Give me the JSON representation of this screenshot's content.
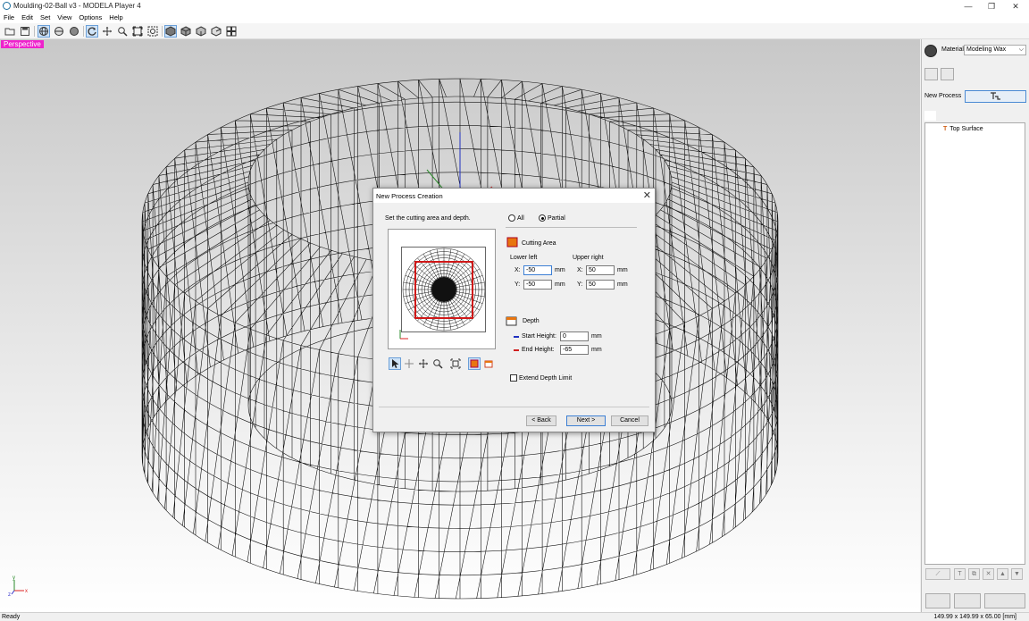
{
  "window": {
    "title": "Moulding-02-Ball v3 - MODELA Player 4",
    "min": "—",
    "max": "❐",
    "close": "✕"
  },
  "menu": [
    "File",
    "Edit",
    "Set",
    "View",
    "Options",
    "Help"
  ],
  "viewport": {
    "label": "Perspective",
    "axis_x": "x",
    "axis_y": "y",
    "axis_z": "z"
  },
  "panel": {
    "material_label": "Material",
    "material_value": "Modeling Wax",
    "new_process_label": "New Process",
    "tree_item": "Top Surface"
  },
  "dialog": {
    "title": "New Process Creation",
    "instruction": "Set the cutting area and depth.",
    "option_all": "All",
    "option_partial": "Partial",
    "cutting_area": "Cutting Area",
    "lower_left": "Lower left",
    "upper_right": "Upper right",
    "x_label": "X:",
    "y_label": "Y:",
    "unit": "mm",
    "ll_x": "-50",
    "ll_y": "-50",
    "ur_x": "50",
    "ur_y": "50",
    "depth": "Depth",
    "start_height_label": "Start Height:",
    "start_height": "0",
    "end_height_label": "End Height:",
    "end_height": "-65",
    "extend_depth": "Extend Depth Limit",
    "back": "< Back",
    "next": "Next >",
    "cancel": "Cancel"
  },
  "status": {
    "left": "Ready",
    "right": "149.99 x 149.99 x 65.00 [mm]"
  }
}
